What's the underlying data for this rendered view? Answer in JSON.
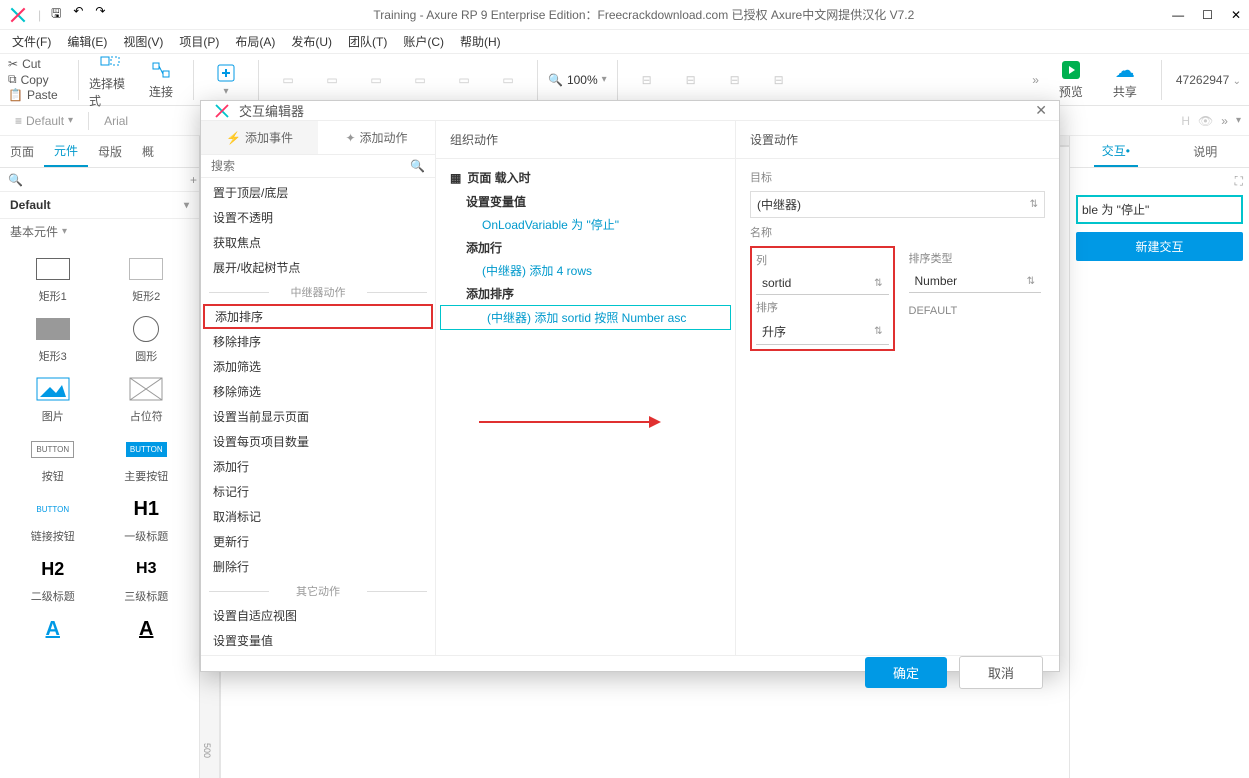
{
  "titlebar": {
    "title": "Training - Axure RP 9 Enterprise Edition：Freecrackdownload.com 已授权    Axure中文网提供汉化 V7.2"
  },
  "menubar": [
    "文件(F)",
    "编辑(E)",
    "视图(V)",
    "项目(P)",
    "布局(A)",
    "发布(U)",
    "团队(T)",
    "账户(C)",
    "帮助(H)"
  ],
  "clipboard": {
    "cut": "Cut",
    "copy": "Copy",
    "paste": "Paste"
  },
  "tools": {
    "select": "选择模式",
    "connect": "连接",
    "insert": "",
    "zoom": "100%",
    "preview": "预览",
    "share": "共享",
    "number": "47262947"
  },
  "subbar": {
    "default": "Default",
    "font": "Arial",
    "h": "H"
  },
  "leftTabs": {
    "page": "页面",
    "component": "元件",
    "master": "母版",
    "outline": "概"
  },
  "library": {
    "name": "Default",
    "section": "基本元件",
    "shapes": [
      {
        "k": "rect1",
        "label": "矩形1"
      },
      {
        "k": "rect2",
        "label": "矩形2"
      },
      {
        "k": "rect3",
        "label": "矩形3"
      },
      {
        "k": "circle",
        "label": "圆形"
      },
      {
        "k": "image",
        "label": "图片"
      },
      {
        "k": "placeholder",
        "label": "占位符"
      },
      {
        "k": "button",
        "label": "按钮"
      },
      {
        "k": "primarybtn",
        "label": "主要按钮"
      },
      {
        "k": "linkbtn",
        "label": "链接按钮"
      },
      {
        "k": "h1",
        "label": "一级标题"
      },
      {
        "k": "h2",
        "label": "二级标题"
      },
      {
        "k": "h3",
        "label": "三级标题"
      }
    ],
    "buttonText": "BUTTON"
  },
  "rightTabs": {
    "interact": "交互•",
    "notes": "说明"
  },
  "rightPane": {
    "eventHint": "ble 为 \"停止\"",
    "newInteract": "新建交互"
  },
  "dialog": {
    "title": "交互编辑器",
    "tabs": {
      "addEvent": "添加事件",
      "addAction": "添加动作"
    },
    "searchPlaceholder": "搜索",
    "actions": [
      {
        "t": "置于顶层/底层"
      },
      {
        "t": "设置不透明"
      },
      {
        "t": "获取焦点"
      },
      {
        "t": "展开/收起树节点"
      },
      {
        "divider": "中继器动作"
      },
      {
        "t": "添加排序",
        "boxed": true
      },
      {
        "t": "移除排序"
      },
      {
        "t": "添加筛选"
      },
      {
        "t": "移除筛选"
      },
      {
        "t": "设置当前显示页面"
      },
      {
        "t": "设置每页项目数量"
      },
      {
        "t": "添加行"
      },
      {
        "t": "标记行"
      },
      {
        "t": "取消标记"
      },
      {
        "t": "更新行"
      },
      {
        "t": "删除行"
      },
      {
        "divider": "其它动作"
      },
      {
        "t": "设置自适应视图"
      },
      {
        "t": "设置变量值"
      }
    ],
    "orgHeader": "组织动作",
    "orgTree": {
      "root": "页面 载入时",
      "items": [
        {
          "h": "设置变量值",
          "d": "OnLoadVariable 为 \"停止\""
        },
        {
          "h": "添加行",
          "d": "(中继器) 添加 4 rows"
        },
        {
          "h": "添加排序",
          "d": "(中继器) 添加 sortid 按照 Number asc",
          "sel": true
        }
      ]
    },
    "setHeader": "设置动作",
    "set": {
      "targetLabel": "目标",
      "targetValue": "(中继器)",
      "nameLabel": "名称",
      "colLabel": "列",
      "colValue": "sortid",
      "typeLabel": "排序类型",
      "typeValue": "Number",
      "orderLabel": "排序",
      "orderValue": "升序",
      "defaultLabel": "DEFAULT"
    },
    "ok": "确定",
    "cancel": "取消"
  }
}
